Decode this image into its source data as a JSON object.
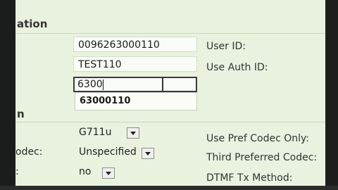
{
  "section_top": {
    "title": "ation"
  },
  "section_mid": {
    "title": "n"
  },
  "fields": {
    "auth_name": {
      "value": "0096263000110"
    },
    "display_name": {
      "value": "TEST110"
    },
    "password": {
      "value": "6300"
    },
    "suggestion": {
      "text": "63000110"
    }
  },
  "labels": {
    "user_id": "User ID:",
    "use_auth_id": "Use Auth ID:",
    "use_pref_codec_only": "Use Pref Codec Only:",
    "third_preferred_codec": "Third Preferred Codec:",
    "dtmf_tx_method": "DTMF Tx Method:",
    "codec_left": "odec:",
    "colon_left": ":"
  },
  "selects": {
    "preferred_codec": {
      "value": "G711u"
    },
    "third_codec": {
      "value": "Unspecified"
    },
    "option_no": {
      "value": "no"
    }
  }
}
